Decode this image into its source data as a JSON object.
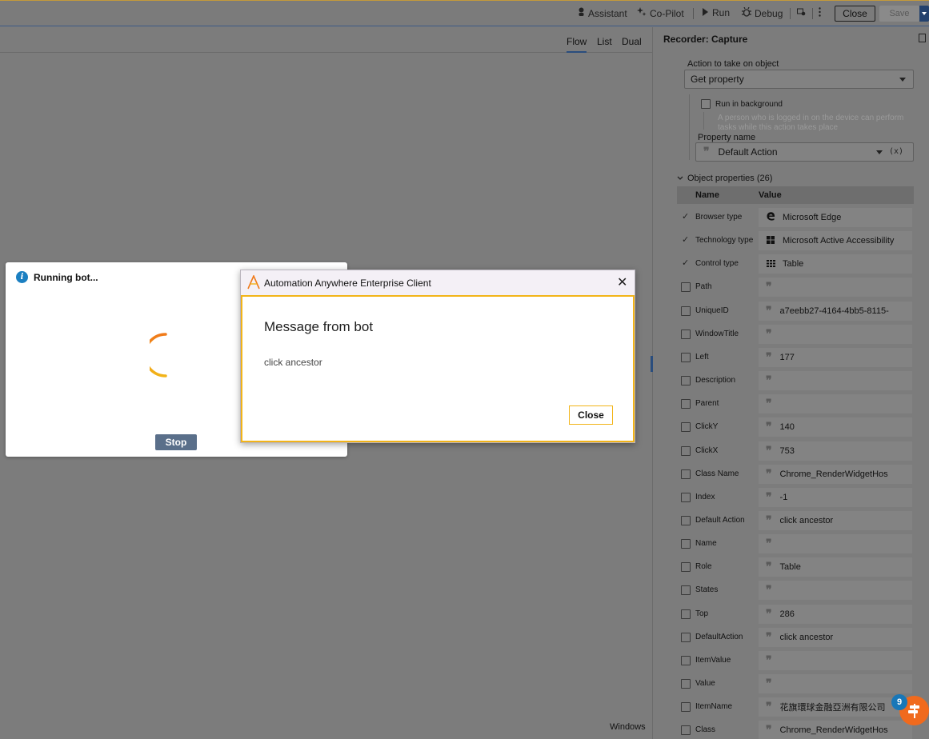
{
  "toolbar": {
    "assistant": "Assistant",
    "copilot": "Co-Pilot",
    "run": "Run",
    "debug": "Debug",
    "close": "Close",
    "save": "Save"
  },
  "view_tabs": {
    "flow": "Flow",
    "list": "List",
    "dual": "Dual",
    "active": "Flow"
  },
  "canvas_footer": "Windows",
  "panel": {
    "title": "Recorder: Capture",
    "action_label": "Action to take on object",
    "action_value": "Get property",
    "run_in_background_label": "Run in background",
    "run_in_background_hint": "A person who is logged in on the device can perform tasks while this action takes place",
    "property_name_label": "Property name",
    "property_name_value": "Default Action",
    "fx_label": "(x)",
    "object_properties_label": "Object properties (26)",
    "col_name": "Name",
    "col_value": "Value",
    "rows": [
      {
        "name": "Browser type",
        "value": "Microsoft Edge",
        "checked": true,
        "icon": "edge-icon"
      },
      {
        "name": "Technology type",
        "value": "Microsoft Active Accessibility",
        "checked": true,
        "icon": "windows-icon"
      },
      {
        "name": "Control type",
        "value": "Table",
        "checked": true,
        "icon": "table-icon"
      },
      {
        "name": "Path",
        "value": "",
        "checked": false
      },
      {
        "name": "UniqueID",
        "value": "a7eebb27-4164-4bb5-8115-",
        "checked": false
      },
      {
        "name": "WindowTitle",
        "value": "",
        "checked": false
      },
      {
        "name": "Left",
        "value": "177",
        "checked": false
      },
      {
        "name": "Description",
        "value": "",
        "checked": false
      },
      {
        "name": "Parent",
        "value": "",
        "checked": false
      },
      {
        "name": "ClickY",
        "value": "140",
        "checked": false
      },
      {
        "name": "ClickX",
        "value": "753",
        "checked": false
      },
      {
        "name": "Class Name",
        "value": "Chrome_RenderWidgetHos",
        "checked": false
      },
      {
        "name": "Index",
        "value": "-1",
        "checked": false
      },
      {
        "name": "Default Action",
        "value": "click ancestor",
        "checked": false
      },
      {
        "name": "Name",
        "value": "",
        "checked": false
      },
      {
        "name": "Role",
        "value": "Table",
        "checked": false
      },
      {
        "name": "States",
        "value": "",
        "checked": false
      },
      {
        "name": "Top",
        "value": "286",
        "checked": false
      },
      {
        "name": "DefaultAction",
        "value": "click ancestor",
        "checked": false
      },
      {
        "name": "ItemValue",
        "value": "",
        "checked": false
      },
      {
        "name": "Value",
        "value": "",
        "checked": false
      },
      {
        "name": "ItemName",
        "value": "花旗環球金融亞洲有限公司",
        "checked": false
      },
      {
        "name": "Class",
        "value": "Chrome_RenderWidgetHos",
        "checked": false
      }
    ]
  },
  "running_dialog": {
    "title": "Running bot...",
    "stop": "Stop"
  },
  "message_dialog": {
    "window_title": "Automation Anywhere Enterprise Client",
    "heading": "Message from bot",
    "message": "click ancestor",
    "close": "Close"
  },
  "fab": {
    "badge": "9"
  },
  "colors": {
    "accent": "#f2b418",
    "brand_orange": "#f06a1d",
    "info_blue": "#1b7fc1",
    "nav_blue": "#24426e"
  }
}
